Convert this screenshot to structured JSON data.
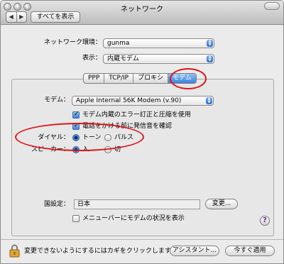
{
  "window": {
    "title": "ネットワーク"
  },
  "toolbar": {
    "back_label": "◀",
    "forward_label": "▶",
    "show_all_label": "すべてを表示"
  },
  "location": {
    "label": "ネットワーク環境：",
    "value": "gunma"
  },
  "show": {
    "label": "表示：",
    "value": "内蔵モデム"
  },
  "tabs": [
    {
      "label": "PPP"
    },
    {
      "label": "TCP/IP"
    },
    {
      "label": "プロキシ"
    },
    {
      "label": "モデム"
    }
  ],
  "modem": {
    "label": "モデム：",
    "value": "Apple Internal 56K Modem (v.90)",
    "error_correction_label": "モデム内蔵のエラー訂正と圧縮を使用",
    "dial_tone_label": "電話をかける前に発信音を確認"
  },
  "dialing": {
    "label": "ダイヤル：",
    "tone_label": "トーン",
    "pulse_label": "パルス"
  },
  "speaker": {
    "label": "スピーカー：",
    "on_label": "入",
    "off_label": "切"
  },
  "country": {
    "label": "国設定：",
    "value": "日本",
    "change_label": "変更..."
  },
  "menubar_status_label": "メニューバーにモデムの状況を表示",
  "help_label": "?",
  "footer": {
    "lock_text": "変更できないようにするにはカギをクリックします。",
    "assistant_label": "アシスタント...",
    "apply_label": "今すぐ適用"
  }
}
